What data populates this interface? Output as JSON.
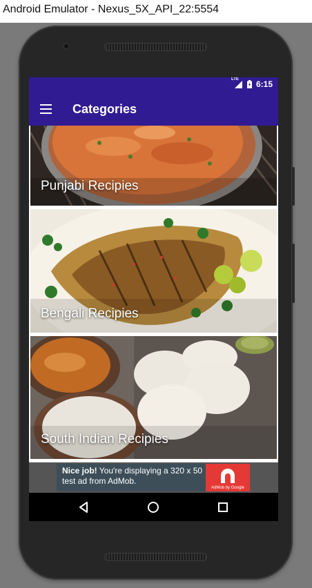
{
  "window": {
    "title": "Android Emulator - Nexus_5X_API_22:5554"
  },
  "status_bar": {
    "network": "LTE",
    "time": "6:15"
  },
  "toolbar": {
    "title": "Categories",
    "menu_icon": "hamburger-menu-icon",
    "color": "#311b92"
  },
  "categories": [
    {
      "label": "Punjabi Recipies"
    },
    {
      "label": "Bengali Recipies"
    },
    {
      "label": "South Indian Recipies"
    }
  ],
  "ad": {
    "bold_text": "Nice job!",
    "text": " You're displaying a 320 x 50 test ad from AdMob.",
    "logo_caption": "AdMob by Google",
    "accent": "#e53935"
  },
  "nav": {
    "back": "back-icon",
    "home": "home-icon",
    "recents": "recents-icon"
  }
}
